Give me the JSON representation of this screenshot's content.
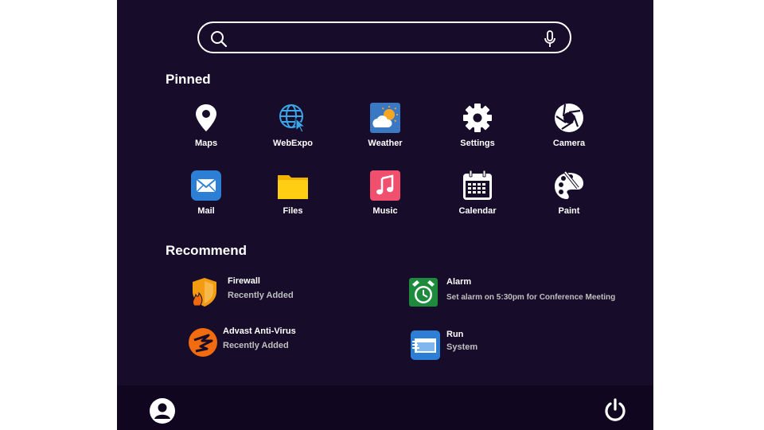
{
  "search": {
    "placeholder": "",
    "value": "",
    "search_icon": "search-icon",
    "mic_icon": "microphone-icon"
  },
  "pinned": {
    "title": "Pinned",
    "items": [
      {
        "label": "Maps",
        "icon": "map-pin-icon"
      },
      {
        "label": "WebExpo",
        "icon": "web-browser-icon"
      },
      {
        "label": "Weather",
        "icon": "weather-icon"
      },
      {
        "label": "Settings",
        "icon": "gear-icon"
      },
      {
        "label": "Camera",
        "icon": "camera-aperture-icon"
      },
      {
        "label": "Mail",
        "icon": "mail-icon"
      },
      {
        "label": "Files",
        "icon": "folder-icon"
      },
      {
        "label": "Music",
        "icon": "music-icon"
      },
      {
        "label": "Calendar",
        "icon": "calendar-icon"
      },
      {
        "label": "Paint",
        "icon": "paint-palette-icon"
      }
    ]
  },
  "recommend": {
    "title": "Recommend",
    "items": [
      {
        "name": "Firewall",
        "detail": "Recently Added",
        "icon": "firewall-shield-icon"
      },
      {
        "name": "Alarm",
        "detail": "Set alarm on 5:30pm for Conference Meeting",
        "icon": "alarm-clock-icon"
      },
      {
        "name": "Advast Anti-Virus",
        "detail": "Recently Added",
        "icon": "antivirus-icon"
      },
      {
        "name": "Run",
        "detail": "System",
        "icon": "run-dialog-icon"
      }
    ]
  },
  "footer": {
    "user_icon": "user-avatar-icon",
    "power_icon": "power-icon"
  },
  "colors": {
    "menu_background": "#170d2b",
    "footer_background": "#100620",
    "text": "#ffffff",
    "secondary_text": "#bfbfbf"
  }
}
